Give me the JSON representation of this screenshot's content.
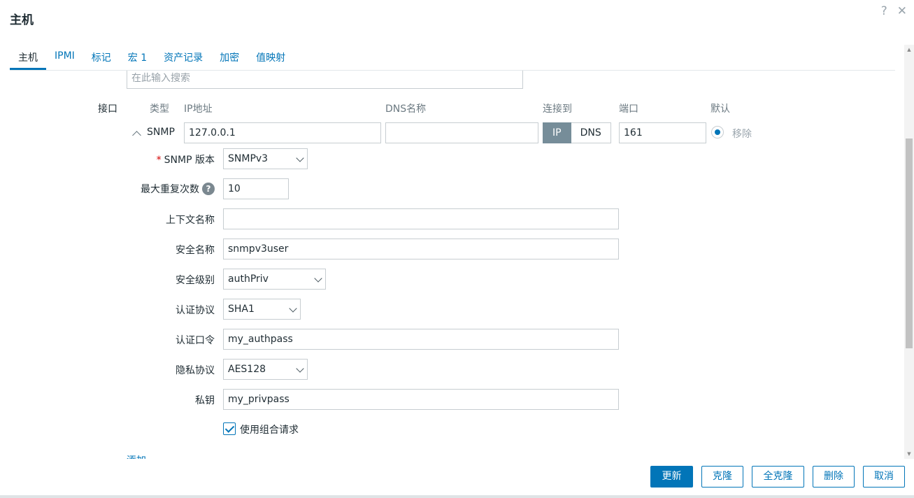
{
  "dialog": {
    "title": "主机",
    "help": "?",
    "close": "✕"
  },
  "tabs": [
    {
      "label": "主机"
    },
    {
      "label": "IPMI"
    },
    {
      "label": "标记"
    },
    {
      "label": "宏 1"
    },
    {
      "label": "资产记录"
    },
    {
      "label": "加密"
    },
    {
      "label": "值映射"
    }
  ],
  "search": {
    "placeholder": "在此输入搜索"
  },
  "interfaces": {
    "label": "接口",
    "columns": {
      "type": "类型",
      "ip": "IP地址",
      "dns": "DNS名称",
      "connect": "连接到",
      "port": "端口",
      "default": "默认"
    },
    "snmp": {
      "type": "SNMP",
      "ip": "127.0.0.1",
      "dns": "",
      "connect_ip": "IP",
      "connect_dns": "DNS",
      "port": "161",
      "remove": "移除"
    }
  },
  "snmp_form": {
    "version": {
      "label": "SNMP 版本",
      "required_mark": "*",
      "value": "SNMPv3"
    },
    "max_repetitions": {
      "label": "最大重复次数",
      "help": "?",
      "value": "10"
    },
    "context_name": {
      "label": "上下文名称",
      "value": ""
    },
    "security_name": {
      "label": "安全名称",
      "value": "snmpv3user"
    },
    "security_level": {
      "label": "安全级别",
      "value": "authPriv"
    },
    "auth_protocol": {
      "label": "认证协议",
      "value": "SHA1"
    },
    "auth_passphrase": {
      "label": "认证口令",
      "value": "my_authpass"
    },
    "priv_protocol": {
      "label": "隐私协议",
      "value": "AES128"
    },
    "priv_key": {
      "label": "私钥",
      "value": "my_privpass"
    },
    "bulk": {
      "label": "使用组合请求",
      "checked": true
    }
  },
  "add_link": "添加",
  "footer": {
    "update": "更新",
    "clone": "克隆",
    "full_clone": "全克隆",
    "delete": "删除",
    "cancel": "取消"
  }
}
